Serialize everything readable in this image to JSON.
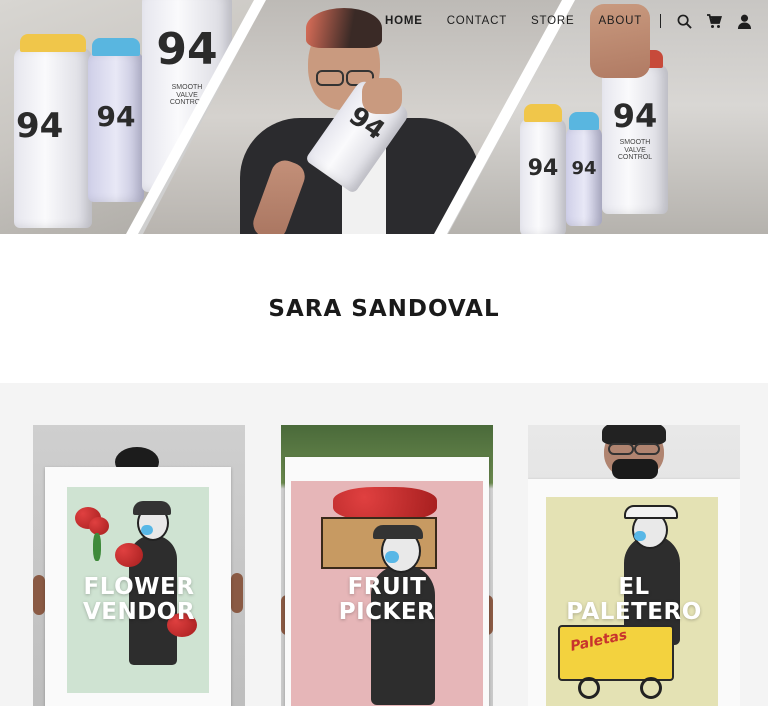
{
  "nav": {
    "items": [
      {
        "label": "HOME",
        "active": true
      },
      {
        "label": "CONTACT",
        "active": false
      },
      {
        "label": "STORE",
        "active": false
      },
      {
        "label": "ABOUT",
        "active": false
      }
    ],
    "icons": [
      "search-icon",
      "cart-icon",
      "account-icon"
    ]
  },
  "hero": {
    "can_label": "94",
    "can_text": "SMOOTH VALVE CONTROL"
  },
  "page": {
    "title": "SARA SANDOVAL"
  },
  "gallery": {
    "cards": [
      {
        "line1": "FLOWER",
        "line2": "VENDOR",
        "print_color": "#cfe3d2"
      },
      {
        "line1": "FRUIT",
        "line2": "PICKER",
        "print_color": "#e6b6b8"
      },
      {
        "line1": "EL",
        "line2": "PALETERO",
        "print_color": "#e4e2b4"
      }
    ],
    "paletas_text": "Paletas"
  },
  "colors": {
    "background": "#ffffff",
    "gallery_background": "#f4f4f4",
    "text": "#1e1e1e",
    "card_text": "#ffffff"
  }
}
